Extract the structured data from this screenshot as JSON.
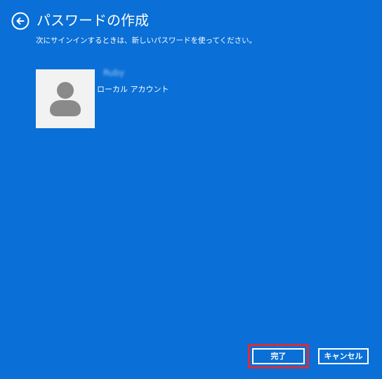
{
  "header": {
    "back_icon": "back-arrow-icon",
    "title": "パスワードの作成",
    "subtitle": "次にサインインするときは、新しいパスワードを使ってください。"
  },
  "account": {
    "avatar_icon": "user-silhouette-icon",
    "name": "Ruby",
    "type": "ローカル アカウント"
  },
  "actions": {
    "finish_label": "完了",
    "cancel_label": "キャンセル"
  },
  "colors": {
    "background": "#0a6fd6",
    "foreground": "#ffffff",
    "highlight": "#d62d3c",
    "avatar_background": "#f2f2f2",
    "avatar_icon": "#8a8a8a"
  }
}
